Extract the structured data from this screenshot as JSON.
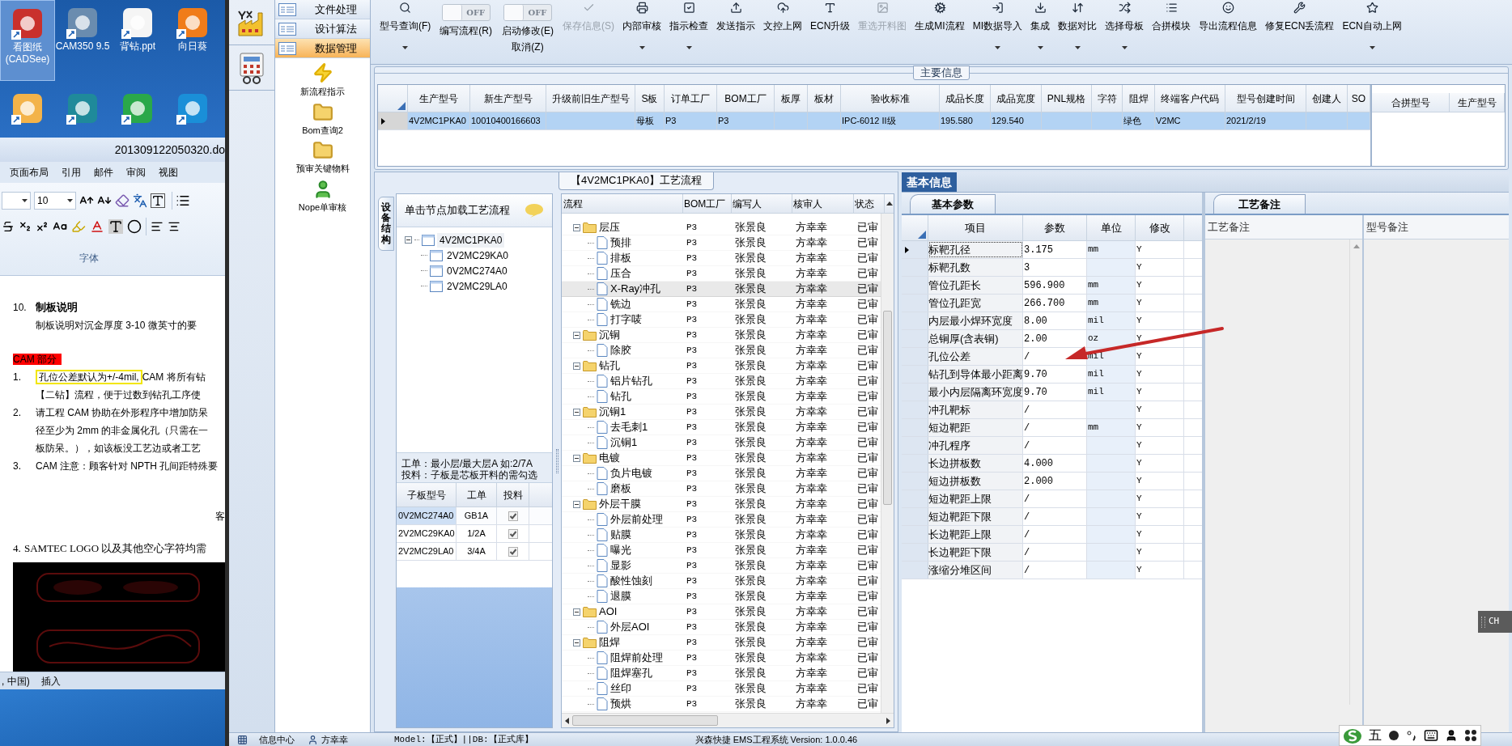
{
  "desktop": {
    "icons": [
      {
        "label": "看图纸 (CADSee)",
        "selected": true
      },
      {
        "label": "CAM350 9.5",
        "selected": false
      },
      {
        "label": "背钻.ppt",
        "selected": false
      },
      {
        "label": "向日葵",
        "selected": false
      }
    ]
  },
  "word": {
    "title": "201309122050320.do",
    "tabs": [
      "页面布局",
      "引用",
      "邮件",
      "审阅",
      "视图"
    ],
    "font_size": "10",
    "group_label": "字体",
    "doc": [
      {
        "kind": "heading",
        "number": "10.",
        "text": "制板说明"
      },
      {
        "kind": "para",
        "text": "制板说明对沉金厚度 3-10 微英寸的要"
      },
      {
        "kind": "tag",
        "text": "CAM 部分"
      },
      {
        "kind": "item",
        "number": "1.",
        "highlight": "孔位公差默认为+/-4mil,",
        "lines": [
          "CAM 将所有钻",
          "【二钻】流程，便于过数到钻孔工序使"
        ]
      },
      {
        "kind": "item",
        "number": "2.",
        "lines": [
          "请工程 CAM 协助在外形程序中增加防呆",
          "径至少为 2mm 的非金属化孔（只需在一",
          "板防呆。），如该板没工艺边或者工艺"
        ]
      },
      {
        "kind": "item",
        "number": "3.",
        "lines": [
          "CAM 注意：顾客针对 NPTH 孔间距特殊要"
        ]
      },
      {
        "kind": "note",
        "text": "客"
      },
      {
        "kind": "serif",
        "number": "4.",
        "text": "SAMTEC LOGO 以及其他空心字符均需"
      },
      {
        "kind": "picture"
      }
    ],
    "status": [
      ", 中国)",
      "插入"
    ]
  },
  "nav": [
    {
      "label": "文件处理",
      "selected": false
    },
    {
      "label": "设计算法",
      "selected": false
    },
    {
      "label": "数据管理",
      "selected": true
    }
  ],
  "nav_items": [
    "新流程指示",
    "Bom查询2",
    "预审关键物料",
    "Nope单审核"
  ],
  "toolbar": [
    {
      "kind": "button",
      "label": "型号查询(F)",
      "dropdown": true,
      "disabled": false
    },
    {
      "kind": "toggle",
      "toggle": "OFF",
      "on": false,
      "label": "编写流程(R)"
    },
    {
      "kind": "toggle",
      "toggle": "OFF",
      "on": false,
      "label": "启动修改(E)",
      "sublabel": "取消(Z)"
    },
    {
      "kind": "button",
      "label": "保存信息(S)",
      "dropdown": false,
      "disabled": true
    },
    {
      "kind": "button",
      "label": "内部审核",
      "dropdown": true,
      "disabled": false
    },
    {
      "kind": "button",
      "label": "指示检查",
      "dropdown": true,
      "disabled": false
    },
    {
      "kind": "button",
      "label": "发送指示",
      "dropdown": false,
      "disabled": false
    },
    {
      "kind": "button",
      "label": "文控上网",
      "dropdown": false,
      "disabled": false
    },
    {
      "kind": "button",
      "label": "ECN升级",
      "dropdown": false,
      "disabled": false
    },
    {
      "kind": "button",
      "label": "重选开料图",
      "dropdown": false,
      "disabled": true
    },
    {
      "kind": "button",
      "label": "生成MI流程",
      "dropdown": false,
      "disabled": false
    },
    {
      "kind": "button",
      "label": "MI数据导入",
      "dropdown": true,
      "disabled": false
    },
    {
      "kind": "button",
      "label": "集成",
      "dropdown": true,
      "disabled": false
    },
    {
      "kind": "button",
      "label": "数据对比",
      "dropdown": true,
      "disabled": false
    },
    {
      "kind": "button",
      "label": "选择母板",
      "dropdown": true,
      "disabled": false
    },
    {
      "kind": "button",
      "label": "合拼模块",
      "dropdown": false,
      "disabled": false
    },
    {
      "kind": "button",
      "label": "导出流程信息",
      "dropdown": false,
      "disabled": false
    },
    {
      "kind": "button",
      "label": "修复ECN丢流程",
      "dropdown": false,
      "disabled": false
    },
    {
      "kind": "button",
      "label": "ECN自动上网",
      "dropdown": true,
      "disabled": false
    }
  ],
  "main_info": {
    "legend": "主要信息",
    "columns": [
      "生产型号",
      "新生产型号",
      "升级前旧生产型号",
      "S板",
      "订单工厂",
      "BOM工厂",
      "板厚",
      "板材",
      "验收标准",
      "成品长度",
      "成品宽度",
      "PNL规格",
      "字符",
      "阻焊",
      "终端客户代码",
      "型号创建时间",
      "创建人",
      "SO"
    ],
    "rows": [
      {
        "selected": true,
        "cells": [
          "4V2MC1PKA0",
          "10010400166603",
          null,
          "母板",
          "P3",
          "P3",
          null,
          null,
          "IPC-6012 II级",
          "195.580",
          "129.540",
          null,
          null,
          "绿色",
          "V2MC",
          "2021/2/19",
          null,
          null
        ]
      }
    ],
    "side_columns": [
      "合拼型号",
      "生产型号"
    ]
  },
  "process": {
    "title": "【4V2MC1PKA0】工艺流程",
    "side_tab": "设备结构",
    "hint": "单击节点加载工艺流程",
    "tree": {
      "label": "4V2MC1PKA0",
      "expanded": true,
      "children": [
        "2V2MC29KA0",
        "0V2MC274A0",
        "2V2MC29LA0"
      ]
    },
    "notes": [
      "工单：最小层/最大层A 如:2/7A",
      "投料：子板是芯板开料的需勾选"
    ],
    "sub_table": {
      "columns": [
        "子板型号",
        "工单",
        "投料"
      ],
      "rows": [
        {
          "model": "0V2MC274A0",
          "order": "GB1A",
          "checked": true,
          "selected": true
        },
        {
          "model": "2V2MC29KA0",
          "order": "1/2A",
          "checked": true,
          "selected": false
        },
        {
          "model": "2V2MC29LA0",
          "order": "3/4A",
          "checked": true,
          "selected": false
        }
      ]
    },
    "grid": {
      "columns": [
        "流程",
        "BOM工厂",
        "编写人",
        "核审人",
        "状态"
      ],
      "rows": [
        {
          "kind": "group",
          "step": "层压",
          "expanded": true,
          "factory": "P3",
          "writer": "张景良",
          "reviewer": "方幸幸",
          "status": "已审",
          "selected": false,
          "children": [
            {
              "kind": "step",
              "step": "预排",
              "factory": "P3",
              "writer": "张景良",
              "reviewer": "方幸幸",
              "status": "已审",
              "selected": false
            },
            {
              "kind": "step",
              "step": "排板",
              "factory": "P3",
              "writer": "张景良",
              "reviewer": "方幸幸",
              "status": "已审",
              "selected": false
            },
            {
              "kind": "step",
              "step": "压合",
              "factory": "P3",
              "writer": "张景良",
              "reviewer": "方幸幸",
              "status": "已审",
              "selected": false
            },
            {
              "kind": "step",
              "step": "X-Ray冲孔",
              "factory": "P3",
              "writer": "张景良",
              "reviewer": "方幸幸",
              "status": "已审",
              "selected": true
            },
            {
              "kind": "step",
              "step": "铣边",
              "factory": "P3",
              "writer": "张景良",
              "reviewer": "方幸幸",
              "status": "已审",
              "selected": false
            },
            {
              "kind": "step",
              "step": "打字唛",
              "factory": "P3",
              "writer": "张景良",
              "reviewer": "方幸幸",
              "status": "已审",
              "selected": false
            }
          ]
        },
        {
          "kind": "group",
          "step": "沉铜",
          "expanded": true,
          "factory": "P3",
          "writer": "张景良",
          "reviewer": "方幸幸",
          "status": "已审",
          "selected": false,
          "children": [
            {
              "kind": "step",
              "step": "除胶",
              "factory": "P3",
              "writer": "张景良",
              "reviewer": "方幸幸",
              "status": "已审",
              "selected": false
            }
          ]
        },
        {
          "kind": "group",
          "step": "钻孔",
          "expanded": true,
          "factory": "P3",
          "writer": "张景良",
          "reviewer": "方幸幸",
          "status": "已审",
          "selected": false,
          "children": [
            {
              "kind": "step",
              "step": "铝片钻孔",
              "factory": "P3",
              "writer": "张景良",
              "reviewer": "方幸幸",
              "status": "已审",
              "selected": false
            },
            {
              "kind": "step",
              "step": "钻孔",
              "factory": "P3",
              "writer": "张景良",
              "reviewer": "方幸幸",
              "status": "已审",
              "selected": false
            }
          ]
        },
        {
          "kind": "group",
          "step": "沉铜1",
          "expanded": true,
          "factory": "P3",
          "writer": "张景良",
          "reviewer": "方幸幸",
          "status": "已审",
          "selected": false,
          "children": [
            {
              "kind": "step",
              "step": "去毛刺1",
              "factory": "P3",
              "writer": "张景良",
              "reviewer": "方幸幸",
              "status": "已审",
              "selected": false
            },
            {
              "kind": "step",
              "step": "沉铜1",
              "factory": "P3",
              "writer": "张景良",
              "reviewer": "方幸幸",
              "status": "已审",
              "selected": false
            }
          ]
        },
        {
          "kind": "group",
          "step": "电镀",
          "expanded": true,
          "factory": "P3",
          "writer": "张景良",
          "reviewer": "方幸幸",
          "status": "已审",
          "selected": false,
          "children": [
            {
              "kind": "step",
              "step": "负片电镀",
              "factory": "P3",
              "writer": "张景良",
              "reviewer": "方幸幸",
              "status": "已审",
              "selected": false
            },
            {
              "kind": "step",
              "step": "磨板",
              "factory": "P3",
              "writer": "张景良",
              "reviewer": "方幸幸",
              "status": "已审",
              "selected": false
            }
          ]
        },
        {
          "kind": "group",
          "step": "外层干膜",
          "expanded": true,
          "factory": "P3",
          "writer": "张景良",
          "reviewer": "方幸幸",
          "status": "已审",
          "selected": false,
          "children": [
            {
              "kind": "step",
              "step": "外层前处理",
              "factory": "P3",
              "writer": "张景良",
              "reviewer": "方幸幸",
              "status": "已审",
              "selected": false
            },
            {
              "kind": "step",
              "step": "贴膜",
              "factory": "P3",
              "writer": "张景良",
              "reviewer": "方幸幸",
              "status": "已审",
              "selected": false
            },
            {
              "kind": "step",
              "step": "曝光",
              "factory": "P3",
              "writer": "张景良",
              "reviewer": "方幸幸",
              "status": "已审",
              "selected": false
            },
            {
              "kind": "step",
              "step": "显影",
              "factory": "P3",
              "writer": "张景良",
              "reviewer": "方幸幸",
              "status": "已审",
              "selected": false
            },
            {
              "kind": "step",
              "step": "酸性蚀刻",
              "factory": "P3",
              "writer": "张景良",
              "reviewer": "方幸幸",
              "status": "已审",
              "selected": false
            },
            {
              "kind": "step",
              "step": "退膜",
              "factory": "P3",
              "writer": "张景良",
              "reviewer": "方幸幸",
              "status": "已审",
              "selected": false
            }
          ]
        },
        {
          "kind": "group",
          "step": "AOI",
          "expanded": true,
          "factory": "P3",
          "writer": "张景良",
          "reviewer": "方幸幸",
          "status": "已审",
          "selected": false,
          "children": [
            {
              "kind": "step",
              "step": "外层AOI",
              "factory": "P3",
              "writer": "张景良",
              "reviewer": "方幸幸",
              "status": "已审",
              "selected": false
            }
          ]
        },
        {
          "kind": "group",
          "step": "阻焊",
          "expanded": true,
          "factory": "P3",
          "writer": "张景良",
          "reviewer": "方幸幸",
          "status": "已审",
          "selected": false,
          "children": [
            {
              "kind": "step",
              "step": "阻焊前处理",
              "factory": "P3",
              "writer": "张景良",
              "reviewer": "方幸幸",
              "status": "已审",
              "selected": false
            },
            {
              "kind": "step",
              "step": "阻焊塞孔",
              "factory": "P3",
              "writer": "张景良",
              "reviewer": "方幸幸",
              "status": "已审",
              "selected": false
            },
            {
              "kind": "step",
              "step": "丝印",
              "factory": "P3",
              "writer": "张景良",
              "reviewer": "方幸幸",
              "status": "已审",
              "selected": false
            },
            {
              "kind": "step",
              "step": "预烘",
              "factory": "P3",
              "writer": "张景良",
              "reviewer": "方幸幸",
              "status": "已审",
              "selected": false
            }
          ]
        }
      ]
    }
  },
  "basic": {
    "tabs": [
      {
        "label": "基本信息",
        "selected": true
      }
    ],
    "sub_tab": "基本参数",
    "columns": [
      "项目",
      "参数",
      "单位",
      "修改"
    ],
    "rows": [
      {
        "item": "标靶孔径",
        "value": "3.175",
        "unit": "mm",
        "edit": "Y",
        "selected": true
      },
      {
        "item": "标靶孔数",
        "value": "3",
        "edit": "Y",
        "selected": false
      },
      {
        "item": "管位孔距长",
        "value": "596.900",
        "unit": "mm",
        "edit": "Y",
        "selected": false
      },
      {
        "item": "管位孔距宽",
        "value": "266.700",
        "unit": "mm",
        "edit": "Y",
        "selected": false
      },
      {
        "item": "内层最小焊环宽度",
        "value": "8.00",
        "unit": "mil",
        "edit": "Y",
        "selected": false
      },
      {
        "item": "总铜厚(含表铜)",
        "value": "2.00",
        "unit": "oz",
        "edit": "Y",
        "selected": false
      },
      {
        "item": "孔位公差",
        "value": "/",
        "unit": "mil",
        "edit": "Y",
        "selected": false
      },
      {
        "item": "钻孔到导体最小距离",
        "value": "9.70",
        "unit": "mil",
        "edit": "Y",
        "selected": false
      },
      {
        "item": "最小内层隔离环宽度",
        "value": "9.70",
        "unit": "mil",
        "edit": "Y",
        "selected": false
      },
      {
        "item": "冲孔靶标",
        "value": "/",
        "edit": "Y",
        "selected": false
      },
      {
        "item": "短边靶距",
        "value": "/",
        "unit": "mm",
        "edit": "Y",
        "selected": false
      },
      {
        "item": "冲孔程序",
        "value": "/",
        "edit": "Y",
        "selected": false
      },
      {
        "item": "长边拼板数",
        "value": "4.000",
        "edit": "Y",
        "selected": false
      },
      {
        "item": "短边拼板数",
        "value": "2.000",
        "edit": "Y",
        "selected": false
      },
      {
        "item": "短边靶距上限",
        "value": "/",
        "edit": "Y",
        "selected": false
      },
      {
        "item": "短边靶距下限",
        "value": "/",
        "edit": "Y",
        "selected": false
      },
      {
        "item": "长边靶距上限",
        "value": "/",
        "edit": "Y",
        "selected": false
      },
      {
        "item": "长边靶距下限",
        "value": "/",
        "edit": "Y",
        "selected": false
      },
      {
        "item": "涨缩分堆区间",
        "value": "/",
        "edit": "Y",
        "selected": false
      }
    ],
    "remarks": {
      "tab": "工艺备注",
      "columns": [
        "工艺备注",
        "型号备注"
      ]
    }
  },
  "status_bar": {
    "info": "信息中心",
    "user": "方幸幸",
    "model": "Model:【正式】||DB:【正式库】",
    "system": "兴森快捷 EMS工程系统 Version: 1.0.0.46"
  },
  "ime": {
    "mode": "五",
    "lang": "CH"
  }
}
